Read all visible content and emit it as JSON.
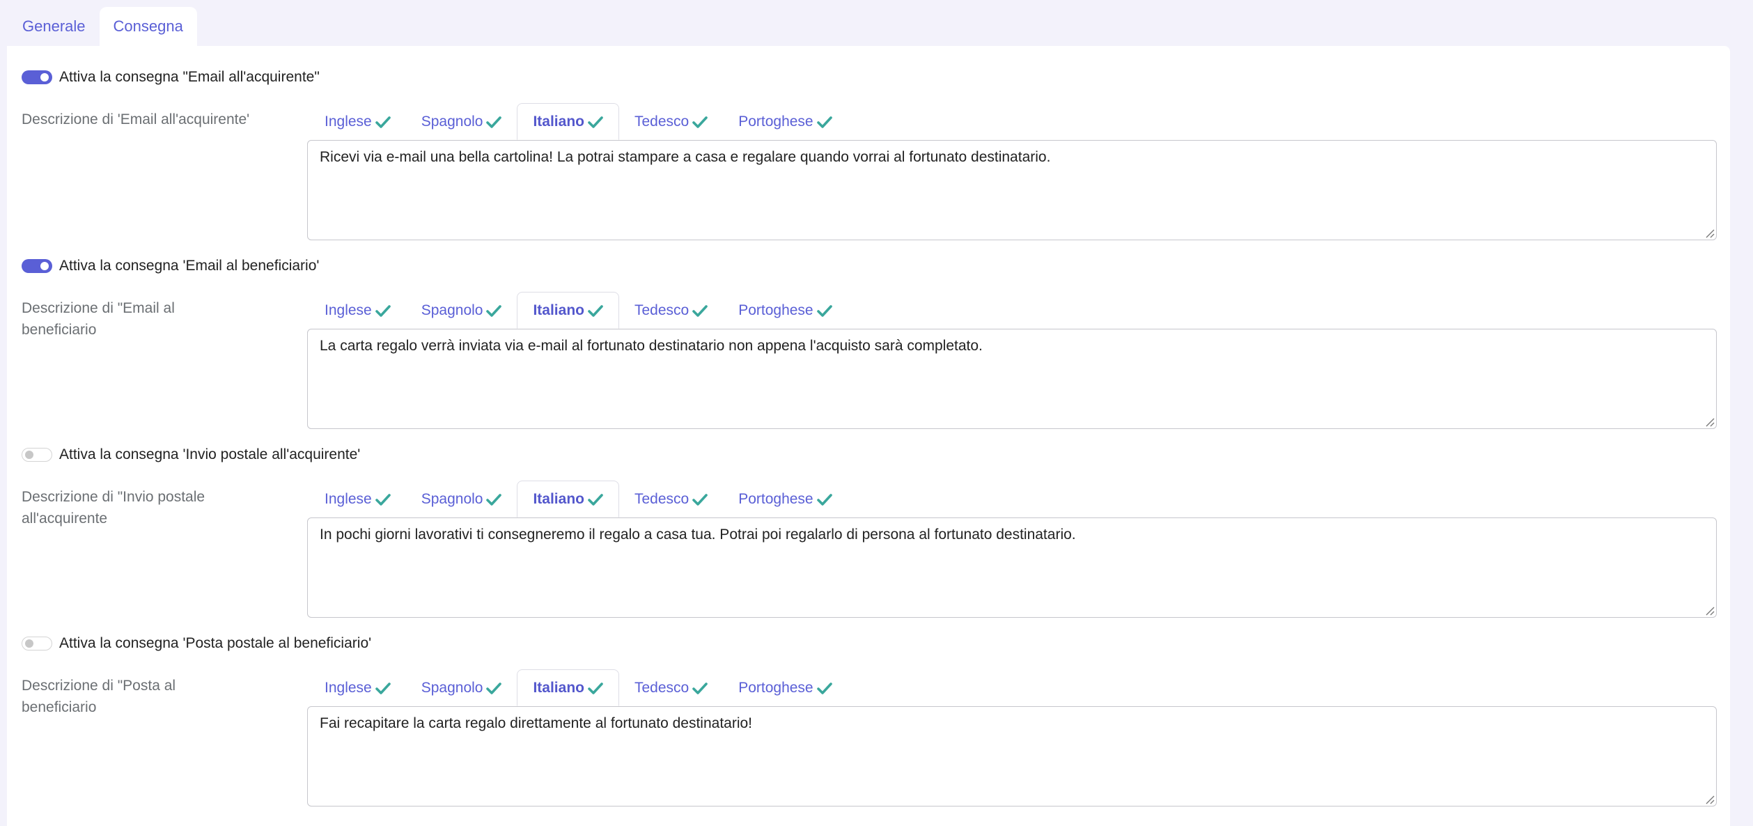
{
  "main_tabs": [
    {
      "label": "Generale",
      "active": false
    },
    {
      "label": "Consegna",
      "active": true
    }
  ],
  "languages": [
    "Inglese",
    "Spagnolo",
    "Italiano",
    "Tedesco",
    "Portoghese"
  ],
  "active_language": "Italiano",
  "colors": {
    "accent": "#5a5fd6",
    "check": "#3aa79c",
    "background": "#f3f2fb"
  },
  "sections": [
    {
      "toggle_on": true,
      "toggle_label": "Attiva la consegna \"Email all'acquirente\"",
      "desc_label": "Descrizione di 'Email all'acquirente'",
      "text": "Ricevi via e-mail una bella cartolina! La potrai stampare a casa e regalare quando vorrai al fortunato destinatario."
    },
    {
      "toggle_on": true,
      "toggle_label": "Attiva la consegna 'Email al beneficiario'",
      "desc_label": "Descrizione di \"Email al beneficiario",
      "text": "La carta regalo verrà inviata via e-mail al fortunato destinatario non appena l'acquisto sarà completato."
    },
    {
      "toggle_on": false,
      "toggle_label": "Attiva la consegna 'Invio postale all'acquirente'",
      "desc_label": "Descrizione di \"Invio postale all'acquirente",
      "text": "In pochi giorni lavorativi ti consegneremo il regalo a casa tua. Potrai poi regalarlo di persona al fortunato destinatario."
    },
    {
      "toggle_on": false,
      "toggle_label": "Attiva la consegna 'Posta postale al beneficiario'",
      "desc_label": "Descrizione di \"Posta al beneficiario",
      "text": "Fai recapitare la carta regalo direttamente al fortunato destinatario!"
    }
  ]
}
